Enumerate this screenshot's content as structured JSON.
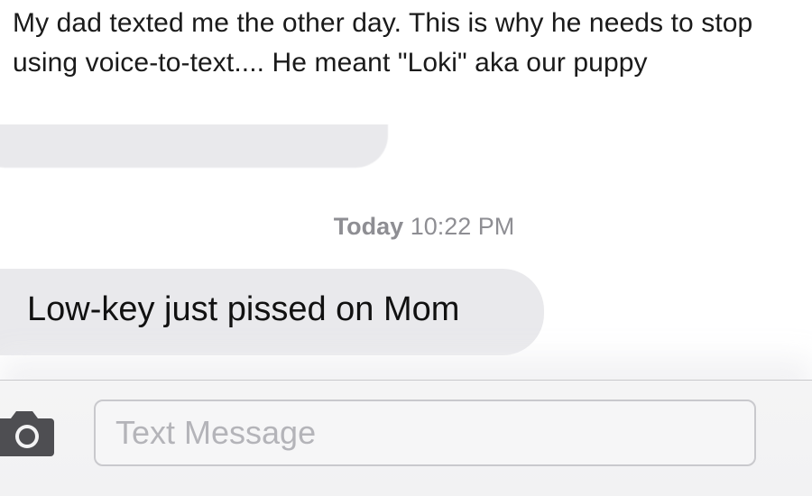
{
  "post": {
    "caption": "My dad texted me the other day. This is why he needs to stop using voice-to-text.... He meant \"Loki\" aka our puppy"
  },
  "conversation": {
    "timestamp_day": "Today",
    "timestamp_time": "10:22 PM",
    "message": "Low-key just pissed on Mom"
  },
  "composer": {
    "placeholder": "Text Message",
    "camera_icon": "camera-icon"
  },
  "colors": {
    "bubble_gray": "#e9e9ec",
    "timestamp_gray": "#8e8e93",
    "placeholder_gray": "#b4b4b9"
  }
}
